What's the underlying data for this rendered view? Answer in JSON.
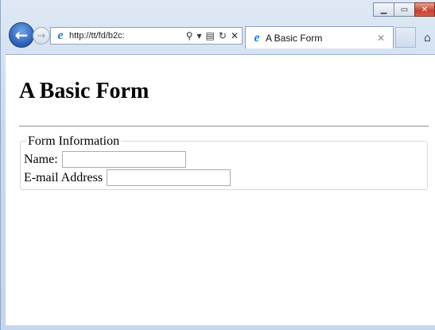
{
  "browser": {
    "address_url": "http://tt/fd/b2c:",
    "tab_title": "A Basic Form",
    "window_controls": [
      "minimize",
      "maximize",
      "close"
    ]
  },
  "page": {
    "title": "A Basic Form",
    "form": {
      "legend": "Form Information",
      "fields": [
        {
          "label": "Name:",
          "value": ""
        },
        {
          "label": "E-mail Address",
          "value": ""
        }
      ]
    }
  }
}
